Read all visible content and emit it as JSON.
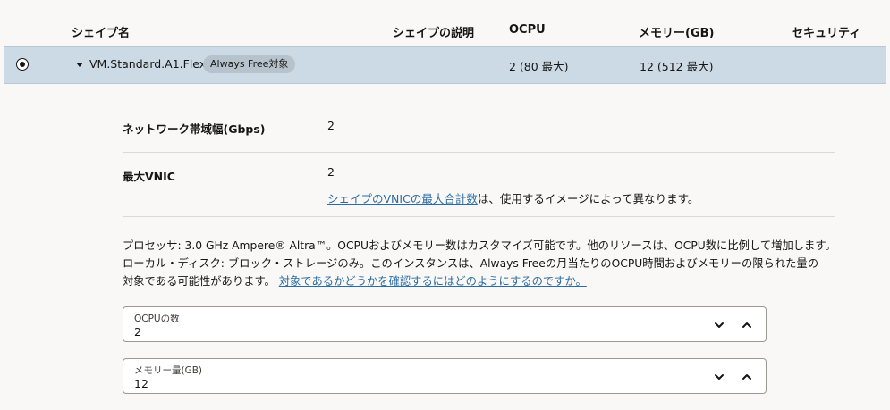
{
  "table": {
    "headers": {
      "name": "シェイプ名",
      "description": "シェイプの説明",
      "ocpu": "OCPU",
      "memory": "メモリー(GB)",
      "security": "セキュリティ"
    },
    "row": {
      "shape_name": "VM.Standard.A1.Flex",
      "badge": "Always Free対象",
      "ocpu": "2 (80 最大)",
      "memory": "12 (512 最大)",
      "selected": true
    }
  },
  "details": {
    "network_label": "ネットワーク帯域幅(Gbps)",
    "network_value": "2",
    "vnic_label": "最大VNIC",
    "vnic_value": "2",
    "vnic_note_link": "シェイプのVNICの最大合計数",
    "vnic_note_rest": "は、使用するイメージによって異なります。",
    "paragraph_line1": "プロセッサ: 3.0 GHz Ampere® Altra™。OCPUおよびメモリー数はカスタマイズ可能です。他のリソースは、OCPU数に比例して増加します。",
    "paragraph_line2": "ローカル・ディスク: ブロック・ストレージのみ。このインスタンスは、Always Freeの月当たりのOCPU時間およびメモリーの限られた量の",
    "paragraph_line3": "対象である可能性があります。",
    "paragraph_link": "対象であるかどうかを確認するにはどのようにするのですか。"
  },
  "fields": {
    "ocpu": {
      "label": "OCPUの数",
      "value": "2"
    },
    "memory": {
      "label": "メモリー量(GB)",
      "value": "12"
    }
  },
  "icons": {
    "decrement": "chevron-down-icon",
    "increment": "chevron-up-icon",
    "expand": "caret-down-icon"
  }
}
